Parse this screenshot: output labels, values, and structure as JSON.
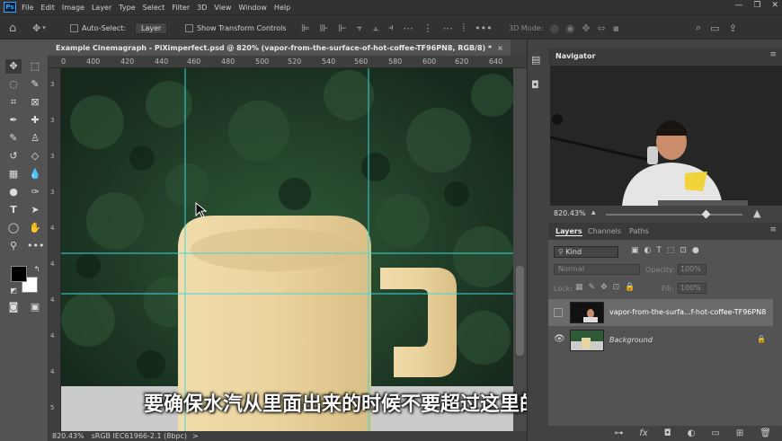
{
  "app": {
    "logo_text": "Ps",
    "menu": [
      "File",
      "Edit",
      "Image",
      "Layer",
      "Type",
      "Select",
      "Filter",
      "3D",
      "View",
      "Window",
      "Help"
    ],
    "window_controls": [
      "—",
      "❐",
      "✕"
    ]
  },
  "options_bar": {
    "auto_select_label": "Auto-Select:",
    "auto_select_value": "Layer",
    "show_transform_label": "Show Transform Controls",
    "mode_3d_label": "3D Mode:"
  },
  "document": {
    "tab_title": "Example Cinemagraph - PiXimperfect.psd @ 820% (vapor-from-the-surface-of-hot-coffee-TF96PN8, RGB/8) *",
    "tab_close": "×"
  },
  "rulers": {
    "horizontal_ticks": [
      "0",
      "400",
      "420",
      "440",
      "460",
      "480",
      "500",
      "520",
      "540",
      "560",
      "580",
      "600",
      "620",
      "640"
    ],
    "vertical_ticks": [
      "3",
      "3",
      "3",
      "3",
      "4",
      "4",
      "4",
      "4",
      "4",
      "5"
    ]
  },
  "status": {
    "zoom": "820.43%",
    "profile": "sRGB IEC61966-2.1 (8bpc)",
    "arrow": ">"
  },
  "subtitle": "要确保水汽从里面出来的时候不要超过这里的线",
  "navigator": {
    "title": "Navigator",
    "zoom": "820.43%"
  },
  "layers_panel": {
    "tabs": [
      "Layers",
      "Channels",
      "Paths"
    ],
    "filter_kind": "Kind",
    "blend_mode": "Normal",
    "opacity_label": "Opacity:",
    "opacity_value": "100%",
    "lock_label": "Lock:",
    "fill_label": "Fill:",
    "fill_value": "100%",
    "layers": [
      {
        "name": "vapor-from-the-surfa...f-hot-coffee-TF96PN8",
        "visible": false,
        "selected": true
      },
      {
        "name": "Background",
        "visible": true,
        "selected": false,
        "locked": true
      }
    ],
    "bottom_icons": [
      "link-icon",
      "fx-icon",
      "mask-icon",
      "adjustment-icon",
      "group-icon",
      "new-layer-icon",
      "trash-icon"
    ]
  },
  "colors": {
    "accent": "#31a8ff",
    "guide": "#3ad6e0",
    "forest": "#1f3a27",
    "mug": "#e8d4a0"
  }
}
